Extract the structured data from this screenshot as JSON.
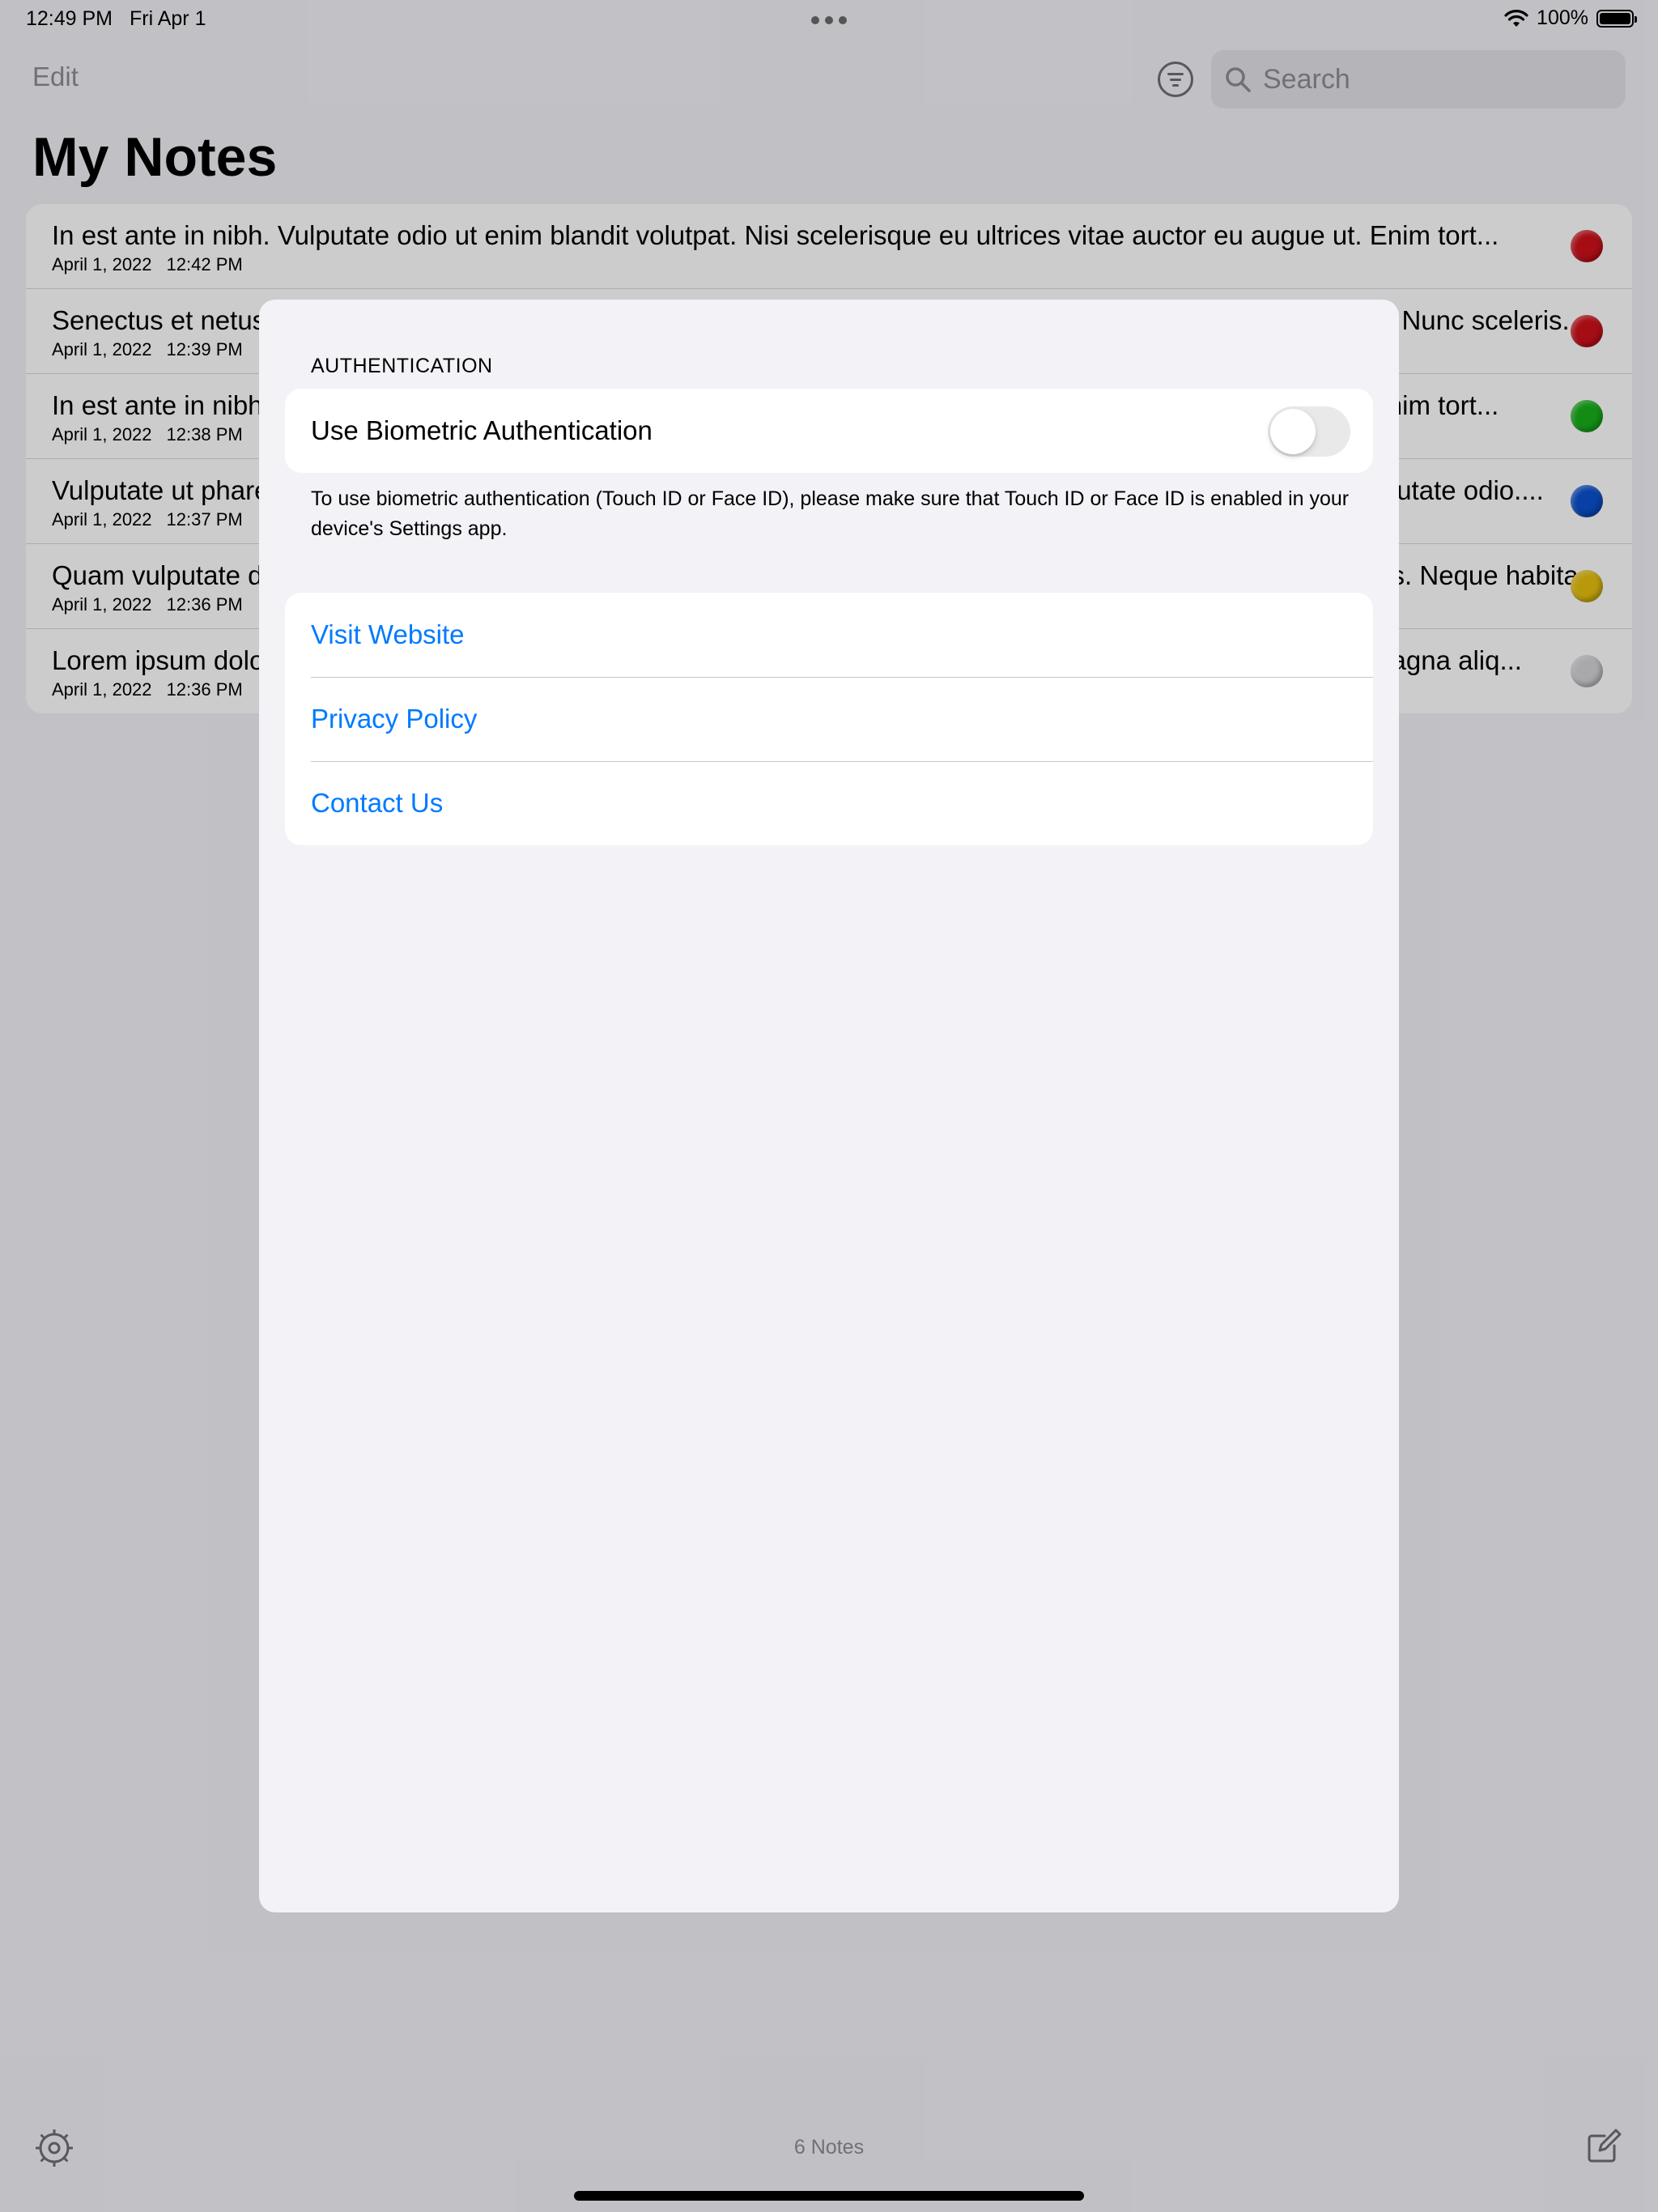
{
  "status_bar": {
    "time": "12:49 PM",
    "date": "Fri Apr 1",
    "battery": "100%",
    "battery_level": 1.0
  },
  "nav": {
    "edit_label": "Edit",
    "filter_icon": "filter-icon",
    "search_placeholder": "Search"
  },
  "page": {
    "title": "My Notes"
  },
  "notes": [
    {
      "title": "In est ante in nibh. Vulputate odio ut enim blandit volutpat. Nisi scelerisque eu ultrices vitae auctor eu augue ut. Enim tort...",
      "date": "April 1, 2022",
      "time": "12:42 PM",
      "color": "#d0101a"
    },
    {
      "title": "Senectus et netus et malesuada fames ac turpis egestas. Pellentesque habitant morbi tristique senectus et netus. Nunc sceleris...",
      "date": "April 1, 2022",
      "time": "12:39 PM",
      "color": "#d0101a"
    },
    {
      "title": "In est ante in nibh. Vulputate odio ut enim blandit volutpat. Nisi scelerisque eu ultrices vitae auctor eu augue ut. Enim tort...",
      "date": "April 1, 2022",
      "time": "12:38 PM",
      "color": "#18b01a"
    },
    {
      "title": "Vulputate ut pharetra sit amet aliquam id diam maecenas. Ultricies mi eget mauris pharetra et ultrices neque. Vulputate odio....",
      "date": "April 1, 2022",
      "time": "12:37 PM",
      "color": "#0a50d0"
    },
    {
      "title": "Quam vulputate dignissim suspendisse in est ante in nibh mauris. Senectus et netus et malesuada fames ac turpis. Neque habita...",
      "date": "April 1, 2022",
      "time": "12:36 PM",
      "color": "#e8c010"
    },
    {
      "title": "Lorem ipsum dolor sit amet, consectetur adipiscing elit, sed do eiusmod tempor incididunt ut labore et dolore ut magna aliq...",
      "date": "April 1, 2022",
      "time": "12:36 PM",
      "color": "#d4d4d8"
    }
  ],
  "toolbar": {
    "settings_icon": "gear-icon",
    "notes_count": "6 Notes",
    "compose_icon": "compose-icon"
  },
  "settings": {
    "auth_header": "AUTHENTICATION",
    "biometric_label": "Use Biometric Authentication",
    "biometric_enabled": false,
    "auth_footer": "To use biometric authentication (Touch ID or Face ID), please make sure that Touch ID or Face ID is enabled in your device's Settings app.",
    "links": [
      {
        "label": "Visit Website"
      },
      {
        "label": "Privacy Policy"
      },
      {
        "label": "Contact Us"
      }
    ],
    "accent_color": "#007aff"
  }
}
